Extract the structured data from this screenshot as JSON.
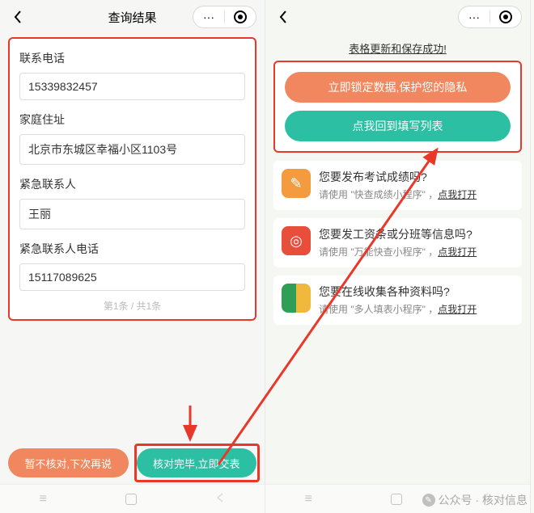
{
  "left": {
    "title": "查询结果",
    "fields": [
      {
        "label": "联系电话",
        "value": "15339832457"
      },
      {
        "label": "家庭住址",
        "value": "北京市东城区幸福小区1103号"
      },
      {
        "label": "紧急联系人",
        "value": "王丽"
      },
      {
        "label": "紧急联系人电话",
        "value": "15117089625"
      }
    ],
    "pager": "第1条 / 共1条",
    "btn_later": "暂不核对,下次再说",
    "btn_submit": "核对完毕,立即交表"
  },
  "right": {
    "saved_msg": "表格更新和保存成功!",
    "btn_lock": "立即锁定数据,保护您的隐私",
    "btn_back": "点我回到填写列表",
    "promos": [
      {
        "title": "您要发布考试成绩吗?",
        "desc_pre": "请使用 \"快查成绩小程序\" ，",
        "link": "点我打开"
      },
      {
        "title": "您要发工资条或分班等信息吗?",
        "desc_pre": "请使用 \"万能快查小程序\" ，",
        "link": "点我打开"
      },
      {
        "title": "您要在线收集各种资料吗?",
        "desc_pre": "请使用 \"多人填表小程序\" ，",
        "link": "点我打开"
      }
    ]
  },
  "watermark": "公众号 · 核对信息"
}
